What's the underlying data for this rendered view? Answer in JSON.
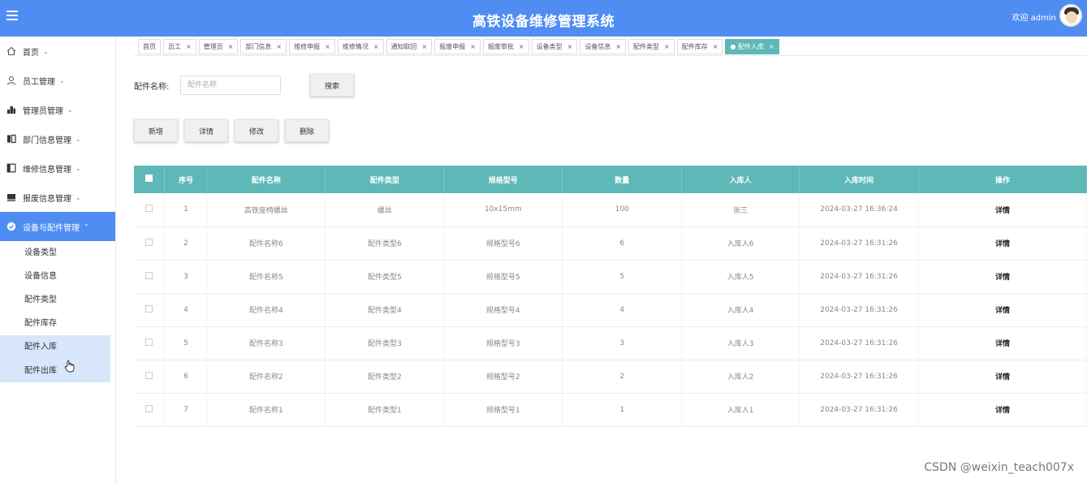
{
  "header": {
    "title": "高铁设备维修管理系统",
    "welcome": "欢迎 admin"
  },
  "sidebar": {
    "items": [
      {
        "label": "首页",
        "chevron": "⌄"
      },
      {
        "label": "员工管理",
        "chevron": "⌄"
      },
      {
        "label": "管理员管理",
        "chevron": "⌄"
      },
      {
        "label": "部门信息管理",
        "chevron": "⌄"
      },
      {
        "label": "维修信息管理",
        "chevron": "⌄"
      },
      {
        "label": "报废信息管理",
        "chevron": "⌄"
      },
      {
        "label": "设备与配件管理",
        "chevron": "⌃"
      }
    ],
    "subitems": [
      "设备类型",
      "设备信息",
      "配件类型",
      "配件库存",
      "配件入库",
      "配件出库"
    ]
  },
  "tabs": [
    {
      "label": "首页",
      "close": ""
    },
    {
      "label": "员工",
      "close": "×"
    },
    {
      "label": "管理员",
      "close": "×"
    },
    {
      "label": "部门信息",
      "close": "×"
    },
    {
      "label": "维修申报",
      "close": "×"
    },
    {
      "label": "维修情况",
      "close": "×"
    },
    {
      "label": "通知取回",
      "close": "×"
    },
    {
      "label": "报废申报",
      "close": "×"
    },
    {
      "label": "报废审批",
      "close": "×"
    },
    {
      "label": "设备类型",
      "close": "×"
    },
    {
      "label": "设备信息",
      "close": "×"
    },
    {
      "label": "配件类型",
      "close": "×"
    },
    {
      "label": "配件库存",
      "close": "×"
    },
    {
      "label": "● 配件入库",
      "close": "×"
    }
  ],
  "search": {
    "label": "配件名称:",
    "placeholder": "配件名称",
    "button": "搜索"
  },
  "actions": {
    "add": "新增",
    "detail": "详情",
    "edit": "修改",
    "delete": "删除"
  },
  "table": {
    "headers": [
      "序号",
      "配件名称",
      "配件类型",
      "规格型号",
      "数量",
      "入库人",
      "入库时间",
      "操作"
    ],
    "rows": [
      {
        "no": "1",
        "name": "高铁座椅螺丝",
        "type": "螺丝",
        "spec": "10x15mm",
        "qty": "100",
        "operator": "张三",
        "time": "2024-03-27 16:36:24",
        "op": "详情"
      },
      {
        "no": "2",
        "name": "配件名称6",
        "type": "配件类型6",
        "spec": "规格型号6",
        "qty": "6",
        "operator": "入库人6",
        "time": "2024-03-27 16:31:26",
        "op": "详情"
      },
      {
        "no": "3",
        "name": "配件名称5",
        "type": "配件类型5",
        "spec": "规格型号5",
        "qty": "5",
        "operator": "入库人5",
        "time": "2024-03-27 16:31:26",
        "op": "详情"
      },
      {
        "no": "4",
        "name": "配件名称4",
        "type": "配件类型4",
        "spec": "规格型号4",
        "qty": "4",
        "operator": "入库人4",
        "time": "2024-03-27 16:31:26",
        "op": "详情"
      },
      {
        "no": "5",
        "name": "配件名称3",
        "type": "配件类型3",
        "spec": "规格型号3",
        "qty": "3",
        "operator": "入库人3",
        "time": "2024-03-27 16:31:26",
        "op": "详情"
      },
      {
        "no": "6",
        "name": "配件名称2",
        "type": "配件类型2",
        "spec": "规格型号2",
        "qty": "2",
        "operator": "入库人2",
        "time": "2024-03-27 16:31:26",
        "op": "详情"
      },
      {
        "no": "7",
        "name": "配件名称1",
        "type": "配件类型1",
        "spec": "规格型号1",
        "qty": "1",
        "operator": "入库人1",
        "time": "2024-03-27 16:31:26",
        "op": "详情"
      }
    ]
  },
  "watermark": "CSDN @weixin_teach007x",
  "colors": {
    "header": "#4f8df2",
    "table_header": "#5fb8b8",
    "sidebar_active": "#4f8df2",
    "sub_highlight": "#d8e6fb"
  }
}
